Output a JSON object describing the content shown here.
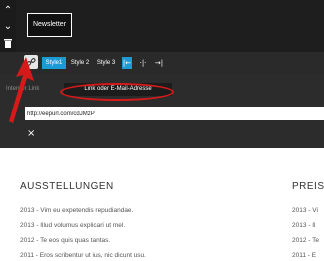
{
  "newsletter": {
    "label": "Newsletter"
  },
  "toolbar": {
    "styles": [
      "Style1",
      "Style 2",
      "Style 3"
    ]
  },
  "link_panel": {
    "tab_internal": "Interner Link",
    "tab_link": "Link oder E-Mail-Adresse",
    "url_value": "http://eepurl.com/cdJMzP",
    "close_label": "×"
  },
  "exhibitions": {
    "heading": "AUSSTELLUNGEN",
    "entries": [
      "2013 - Vim eu expetendis repudiandae.",
      "2013 - Illud volumus explicari ut mel.",
      "2012 - Te eos quis quas tantas.",
      "2011 - Eros scribentur ut ius, nic dicunt usu."
    ]
  },
  "prizes": {
    "heading": "PREIS",
    "entries": [
      "2013 - Vi",
      "2013 - Il",
      "2012 - Te",
      "2011 - E"
    ]
  },
  "colors": {
    "accent": "#1a9bd7",
    "annotation": "#d61a1a"
  }
}
